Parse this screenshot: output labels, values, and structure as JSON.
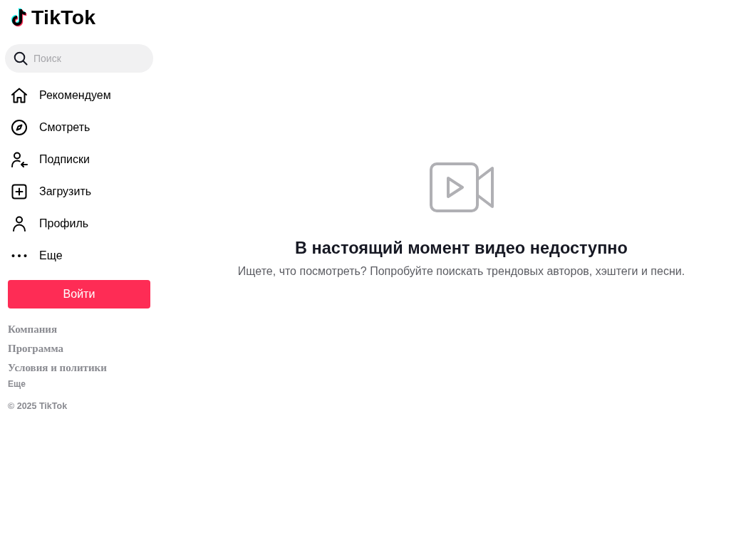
{
  "logo": {
    "text": "TikTok"
  },
  "search": {
    "placeholder": "Поиск"
  },
  "nav": [
    {
      "kind": "home",
      "label": "Рекомендуем",
      "selected": false
    },
    {
      "kind": "explore",
      "label": "Смотреть",
      "selected": false
    },
    {
      "kind": "following",
      "label": "Подписки",
      "selected": false
    },
    {
      "kind": "upload",
      "label": "Загрузить",
      "selected": false
    },
    {
      "kind": "profile",
      "label": "Профиль",
      "selected": false
    },
    {
      "kind": "more",
      "label": "Еще",
      "selected": false
    }
  ],
  "login_button": "Войти",
  "footer_links": [
    "Компания",
    "Программа",
    "Условия и политики"
  ],
  "footer_more": "Еще",
  "copyright": "© 2025 TikTok",
  "empty_state": {
    "title": "В настоящий момент видео недоступно",
    "subtitle": "Ищете, что посмотреть? Попробуйте поискать трендовых авторов, хэштеги и песни."
  }
}
